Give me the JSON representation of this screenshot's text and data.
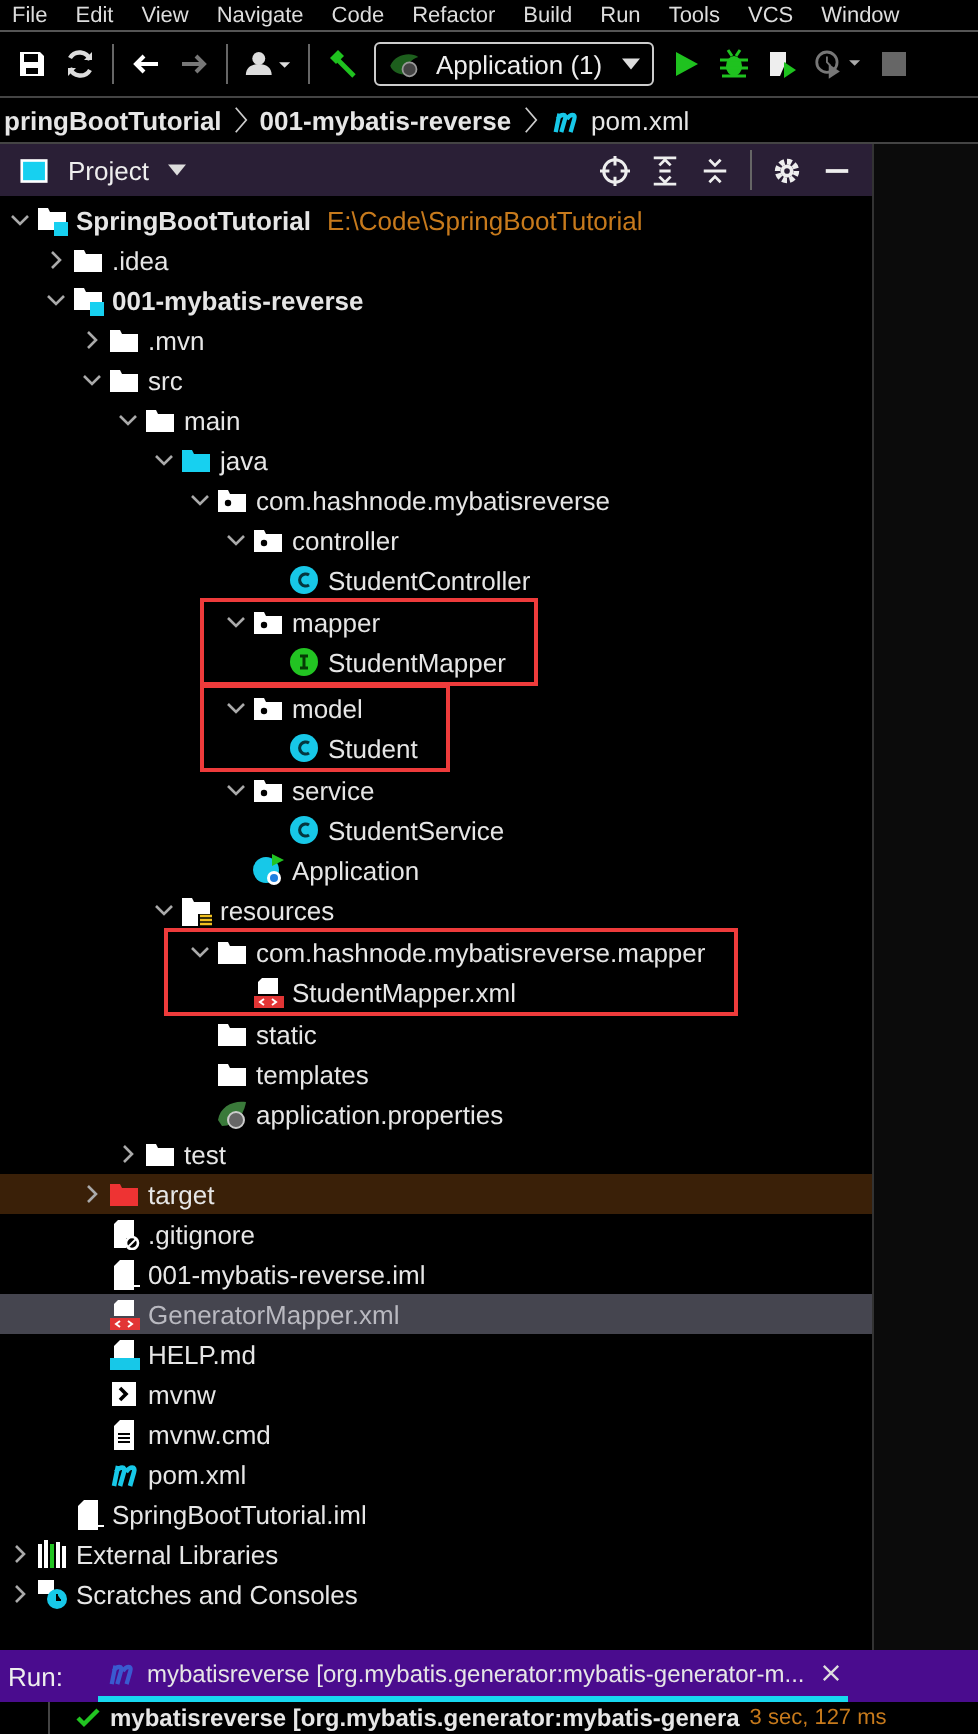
{
  "menu": [
    "File",
    "Edit",
    "View",
    "Navigate",
    "Code",
    "Refactor",
    "Build",
    "Run",
    "Tools",
    "VCS",
    "Window"
  ],
  "toolbar": {
    "run_config": "Application (1)"
  },
  "breadcrumb": [
    {
      "label": "pringBootTutorial",
      "kind": "module"
    },
    {
      "label": "001-mybatis-reverse",
      "kind": "module"
    },
    {
      "label": "pom.xml",
      "kind": "maven"
    }
  ],
  "project_panel": {
    "title": "Project"
  },
  "tree": [
    {
      "name": "SpringBootTutorial",
      "hint": "E:\\Code\\SpringBootTutorial",
      "kind": "module",
      "expanded": true,
      "selected": false,
      "children": [
        {
          "name": ".idea",
          "kind": "folder",
          "expanded": false,
          "selected": false
        },
        {
          "name": "001-mybatis-reverse",
          "kind": "module",
          "expanded": true,
          "selected": false,
          "children": [
            {
              "name": ".mvn",
              "kind": "folder",
              "expanded": false,
              "selected": false
            },
            {
              "name": "src",
              "kind": "folder",
              "expanded": true,
              "selected": false,
              "children": [
                {
                  "name": "main",
                  "kind": "folder",
                  "expanded": true,
                  "selected": false,
                  "children": [
                    {
                      "name": "java",
                      "kind": "source-folder",
                      "expanded": true,
                      "selected": false,
                      "children": [
                        {
                          "name": "com.hashnode.mybatisreverse",
                          "kind": "package",
                          "expanded": true,
                          "selected": false,
                          "children": [
                            {
                              "name": "controller",
                              "kind": "package",
                              "expanded": true,
                              "selected": false,
                              "children": [
                                {
                                  "name": "StudentController",
                                  "kind": "class",
                                  "selected": false
                                }
                              ]
                            },
                            {
                              "name": "mapper",
                              "kind": "package",
                              "expanded": true,
                              "selected": false,
                              "highlighted": true,
                              "children": [
                                {
                                  "name": "StudentMapper",
                                  "kind": "interface",
                                  "selected": false
                                }
                              ]
                            },
                            {
                              "name": "model",
                              "kind": "package",
                              "expanded": true,
                              "selected": false,
                              "highlighted": true,
                              "children": [
                                {
                                  "name": "Student",
                                  "kind": "class",
                                  "selected": false
                                }
                              ]
                            },
                            {
                              "name": "service",
                              "kind": "package",
                              "expanded": true,
                              "selected": false,
                              "children": [
                                {
                                  "name": "StudentService",
                                  "kind": "class",
                                  "selected": false
                                }
                              ]
                            },
                            {
                              "name": "Application",
                              "kind": "spring-class",
                              "selected": false
                            }
                          ]
                        }
                      ]
                    },
                    {
                      "name": "resources",
                      "kind": "resources-folder",
                      "expanded": true,
                      "selected": false,
                      "children": [
                        {
                          "name": "com.hashnode.mybatisreverse.mapper",
                          "kind": "folder",
                          "expanded": true,
                          "selected": false,
                          "highlighted": true,
                          "children": [
                            {
                              "name": "StudentMapper.xml",
                              "kind": "xml",
                              "selected": false
                            }
                          ]
                        },
                        {
                          "name": "static",
                          "kind": "folder",
                          "selected": false
                        },
                        {
                          "name": "templates",
                          "kind": "folder",
                          "selected": false
                        },
                        {
                          "name": "application.properties",
                          "kind": "properties",
                          "selected": false
                        }
                      ]
                    }
                  ]
                },
                {
                  "name": "test",
                  "kind": "folder",
                  "expanded": false,
                  "selected": false
                }
              ]
            },
            {
              "name": "target",
              "kind": "excluded-folder",
              "expanded": false,
              "selected": false
            },
            {
              "name": ".gitignore",
              "kind": "ignore-file",
              "selected": false
            },
            {
              "name": "001-mybatis-reverse.iml",
              "kind": "iml",
              "selected": false
            },
            {
              "name": "GeneratorMapper.xml",
              "kind": "xml",
              "selected": true
            },
            {
              "name": "HELP.md",
              "kind": "markdown",
              "selected": false
            },
            {
              "name": "mvnw",
              "kind": "script",
              "selected": false
            },
            {
              "name": "mvnw.cmd",
              "kind": "text",
              "selected": false
            },
            {
              "name": "pom.xml",
              "kind": "maven",
              "selected": false
            }
          ]
        },
        {
          "name": "SpringBootTutorial.iml",
          "kind": "iml",
          "selected": false
        }
      ]
    },
    {
      "name": "External Libraries",
      "kind": "libraries",
      "expanded": false,
      "selected": false
    },
    {
      "name": "Scratches and Consoles",
      "kind": "scratches",
      "expanded": false,
      "selected": false
    }
  ],
  "run_panel": {
    "label": "Run:",
    "tabs": [
      {
        "title": "mybatisreverse [org.mybatis.generator:mybatis-generator-m...",
        "selected": true
      }
    ],
    "result": {
      "title": "mybatisreverse [org.mybatis.generator:mybatis-genera",
      "time": "3 sec, 127 ms",
      "success": true
    }
  }
}
